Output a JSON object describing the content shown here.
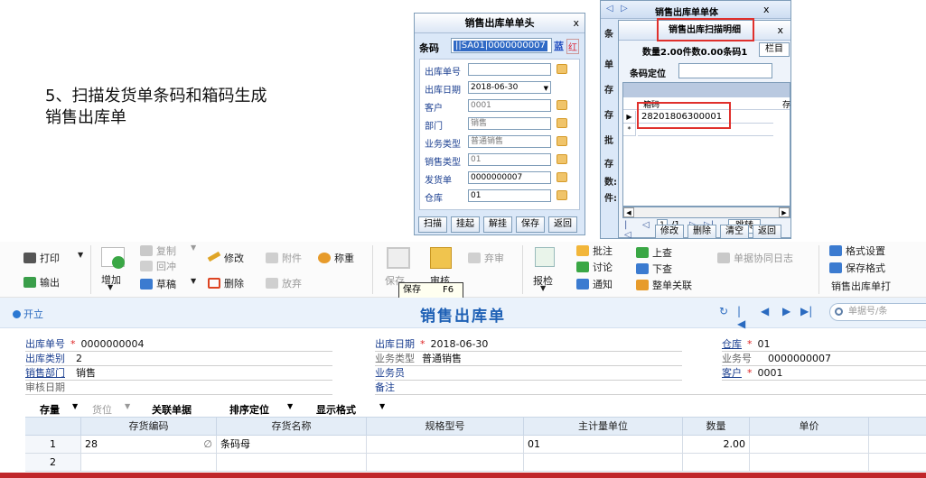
{
  "caption": {
    "line1": "5、扫描发货单条码和箱码生成",
    "line2": "销售出库单"
  },
  "header_dialog": {
    "title": "销售出库单单头",
    "close": "x",
    "barcode_label": "条码",
    "barcode_value": "||SA01|0000000007",
    "tag_blue": "蓝",
    "tag_red": "红",
    "fields": [
      {
        "label": "出库单号",
        "value": ""
      },
      {
        "label": "出库日期",
        "value": "2018-06-30"
      },
      {
        "label": "客户",
        "value": "0001"
      },
      {
        "label": "部门",
        "value": "销售"
      },
      {
        "label": "业务类型",
        "value": "普通销售"
      },
      {
        "label": "销售类型",
        "value": "01"
      },
      {
        "label": "发货单",
        "value": "0000000007"
      },
      {
        "label": "仓库",
        "value": "01"
      }
    ],
    "buttons": [
      "扫描",
      "挂起",
      "解挂",
      "保存",
      "返回"
    ]
  },
  "scan_dialog": {
    "outer_title": "销售出库单单体",
    "outer_close": "x",
    "side_labels": [
      "条",
      "单",
      "存",
      "存",
      "批",
      "存",
      "数:",
      "件:"
    ],
    "title": "销售出库扫描明细",
    "close": "x",
    "info": "数量2.00件数0.00条码1",
    "column_button": "栏目",
    "locate_label": "条码定位",
    "column_header": "箱码",
    "column_header2": "存",
    "rows": [
      {
        "marker": "▶",
        "value": "28201806300001"
      },
      {
        "marker": "*",
        "value": ""
      }
    ],
    "page_input": "1",
    "page_total": "/1",
    "jump_button": "跳转",
    "buttons": [
      "修改",
      "删除",
      "清空",
      "返回"
    ]
  },
  "toolbar": {
    "print": "打印",
    "export": "输出",
    "add": "增加",
    "copy": "复制",
    "draft_grid": "回冲",
    "draft": "草稿",
    "edit": "修改",
    "delete": "删除",
    "attach": "附件",
    "discard": "放弃",
    "weigh": "称重",
    "save": "保存",
    "save_tooltip": "保存",
    "save_key": "F6",
    "audit": "审核",
    "abandon": "弃审",
    "report": "报检",
    "annotate": "批注",
    "discuss": "讨论",
    "notify": "通知",
    "up": "上查",
    "down": "下查",
    "whole": "整单关联",
    "collab_log": "单据协同日志",
    "fmt_setting": "格式设置",
    "save_fmt": "保存格式",
    "fmt_name": "销售出库单打"
  },
  "doc": {
    "status": "开立",
    "title": "销售出库单",
    "search_placeholder": "单据号/条"
  },
  "form": {
    "out_no_label": "出库单号",
    "out_no": "0000000004",
    "out_date_label": "出库日期",
    "out_date": "2018-06-30",
    "warehouse_label": "仓库",
    "warehouse": "01",
    "out_type_label": "出库类别",
    "out_type": "2",
    "biz_type_label": "业务类型",
    "biz_type": "普通销售",
    "biz_no_label": "业务号",
    "biz_no": "0000000007",
    "dept_label": "销售部门",
    "dept": "销售",
    "clerk_label": "业务员",
    "clerk": "",
    "customer_label": "客户",
    "customer": "0001",
    "audit_date_label": "审核日期",
    "audit_date": "",
    "remark_label": "备注",
    "remark": "",
    "req": "*"
  },
  "grid_toolbar": [
    "存量",
    "货位",
    "关联单据",
    "排序定位",
    "显示格式"
  ],
  "table": {
    "headers": [
      "存货编码",
      "存货名称",
      "规格型号",
      "主计量单位",
      "数量",
      "单价"
    ],
    "rows": [
      {
        "no": "1",
        "code": "28",
        "name": "条码母",
        "spec": "",
        "unit": "01",
        "qty": "2.00",
        "price": ""
      },
      {
        "no": "2",
        "code": "",
        "name": "",
        "spec": "",
        "unit": "",
        "qty": "",
        "price": ""
      }
    ]
  },
  "colors": {
    "accent": "#1e60b5",
    "highlight": "#e0302c",
    "footer": "#c0262a"
  }
}
